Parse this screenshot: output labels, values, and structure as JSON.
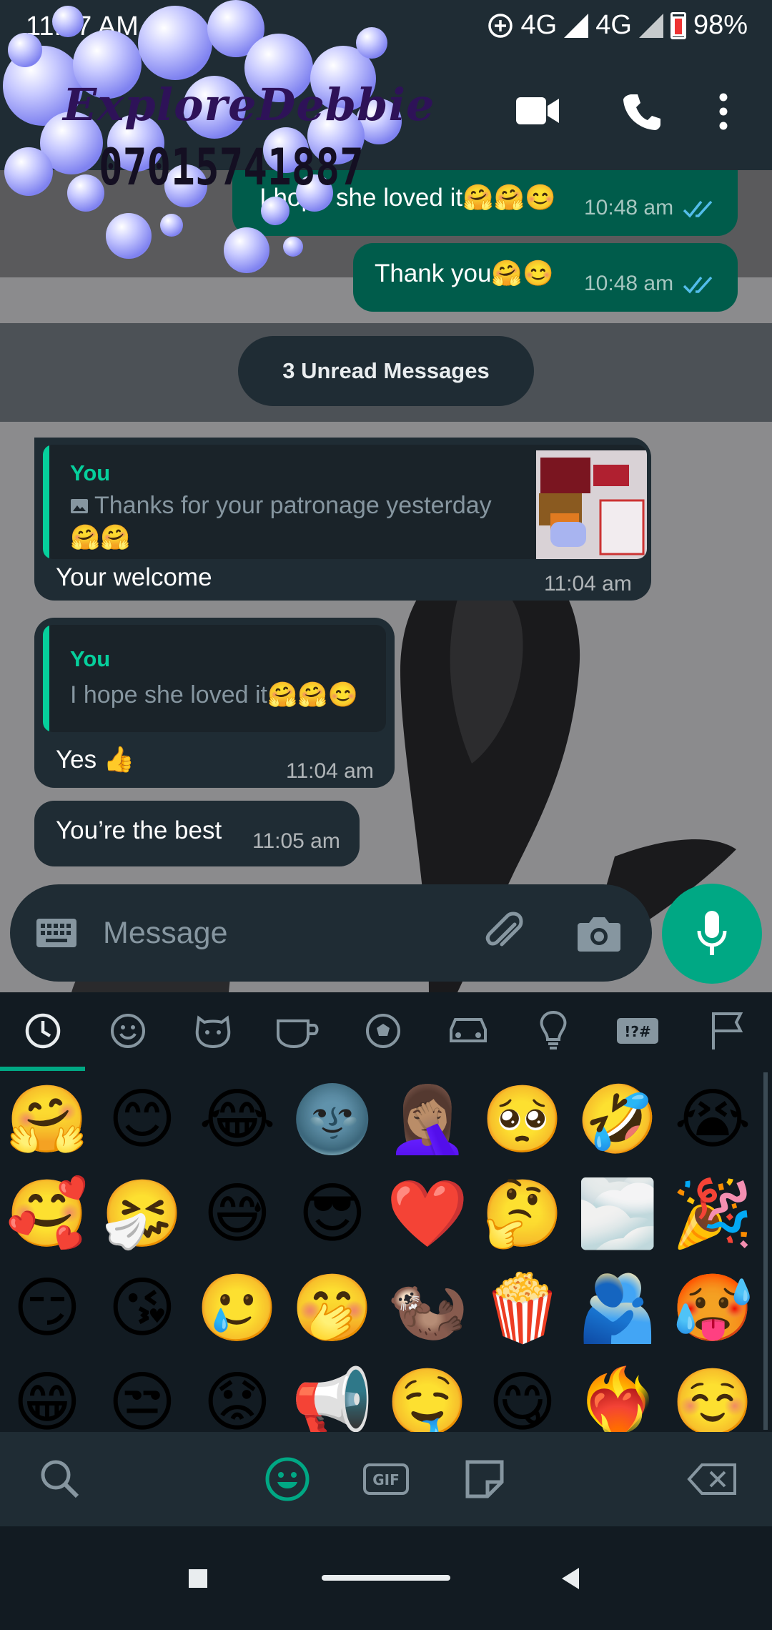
{
  "status": {
    "time": "11:17 AM",
    "network1": "4G",
    "network2": "4G",
    "battery": "98%"
  },
  "logo": {
    "title": "ExploreDebbie",
    "phone": "07015741887"
  },
  "messages": {
    "out1": {
      "text": "I hope she loved it🤗🤗😊",
      "time": "10:48 am"
    },
    "out2": {
      "text": "Thank you🤗😊",
      "time": "10:48 am"
    },
    "unread": "3 Unread Messages",
    "in1": {
      "quote_sender": "You",
      "quote_line1": "Thanks for your patronage yesterday",
      "quote_line2": "🤗🤗",
      "text": "Your welcome",
      "time": "11:04 am"
    },
    "in2": {
      "quote_sender": "You",
      "quote_text": "I hope she loved it🤗🤗😊",
      "text": "Yes 👍",
      "time": "11:04 am"
    },
    "in3": {
      "text": "You’re the best",
      "time": "11:05 am"
    }
  },
  "composer": {
    "placeholder": "Message"
  },
  "emoji_tabs": [
    "recent-icon",
    "smiley-icon",
    "animal-icon",
    "food-icon",
    "activity-icon",
    "travel-icon",
    "objects-icon",
    "symbols-icon",
    "flags-icon"
  ],
  "emoji_rows": [
    [
      "🤗",
      "😊",
      "😂",
      "🌚",
      "🤦🏽‍♀️",
      "🥺",
      "🤣",
      "😭"
    ],
    [
      "🥰",
      "🤧",
      "😅",
      "😎",
      "❤️",
      "🤔",
      "🌫️",
      "🎉"
    ],
    [
      "😏",
      "😘",
      "🥲",
      "🤭",
      "🦦",
      "🍿",
      "🫂",
      "🥵"
    ],
    [
      "😁",
      "😒",
      "😟",
      "📢",
      "🤤",
      "😋",
      "❤️‍🔥",
      "☺️"
    ]
  ],
  "colors": {
    "accent": "#00a884",
    "outgoing": "#005c4b",
    "incoming": "#1f2c34",
    "background": "#121b22"
  }
}
